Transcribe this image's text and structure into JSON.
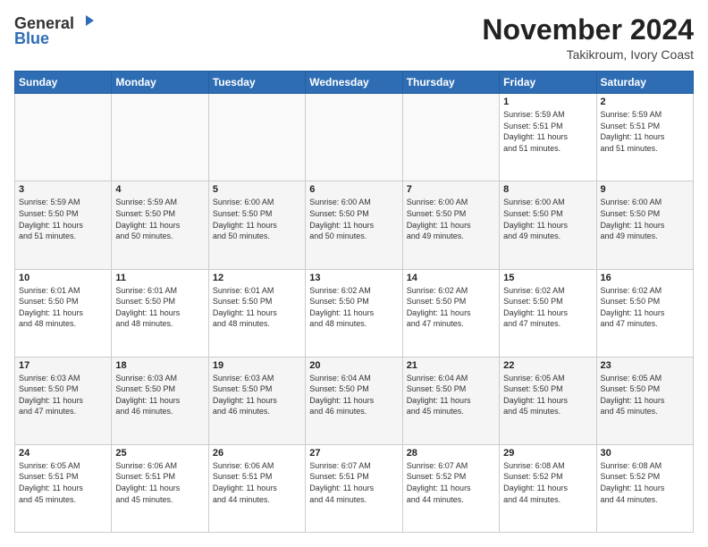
{
  "header": {
    "logo_line1": "General",
    "logo_line2": "Blue",
    "month": "November 2024",
    "location": "Takikroum, Ivory Coast"
  },
  "days_of_week": [
    "Sunday",
    "Monday",
    "Tuesday",
    "Wednesday",
    "Thursday",
    "Friday",
    "Saturday"
  ],
  "weeks": [
    [
      {
        "day": "",
        "info": ""
      },
      {
        "day": "",
        "info": ""
      },
      {
        "day": "",
        "info": ""
      },
      {
        "day": "",
        "info": ""
      },
      {
        "day": "",
        "info": ""
      },
      {
        "day": "1",
        "info": "Sunrise: 5:59 AM\nSunset: 5:51 PM\nDaylight: 11 hours\nand 51 minutes."
      },
      {
        "day": "2",
        "info": "Sunrise: 5:59 AM\nSunset: 5:51 PM\nDaylight: 11 hours\nand 51 minutes."
      }
    ],
    [
      {
        "day": "3",
        "info": "Sunrise: 5:59 AM\nSunset: 5:50 PM\nDaylight: 11 hours\nand 51 minutes."
      },
      {
        "day": "4",
        "info": "Sunrise: 5:59 AM\nSunset: 5:50 PM\nDaylight: 11 hours\nand 50 minutes."
      },
      {
        "day": "5",
        "info": "Sunrise: 6:00 AM\nSunset: 5:50 PM\nDaylight: 11 hours\nand 50 minutes."
      },
      {
        "day": "6",
        "info": "Sunrise: 6:00 AM\nSunset: 5:50 PM\nDaylight: 11 hours\nand 50 minutes."
      },
      {
        "day": "7",
        "info": "Sunrise: 6:00 AM\nSunset: 5:50 PM\nDaylight: 11 hours\nand 49 minutes."
      },
      {
        "day": "8",
        "info": "Sunrise: 6:00 AM\nSunset: 5:50 PM\nDaylight: 11 hours\nand 49 minutes."
      },
      {
        "day": "9",
        "info": "Sunrise: 6:00 AM\nSunset: 5:50 PM\nDaylight: 11 hours\nand 49 minutes."
      }
    ],
    [
      {
        "day": "10",
        "info": "Sunrise: 6:01 AM\nSunset: 5:50 PM\nDaylight: 11 hours\nand 48 minutes."
      },
      {
        "day": "11",
        "info": "Sunrise: 6:01 AM\nSunset: 5:50 PM\nDaylight: 11 hours\nand 48 minutes."
      },
      {
        "day": "12",
        "info": "Sunrise: 6:01 AM\nSunset: 5:50 PM\nDaylight: 11 hours\nand 48 minutes."
      },
      {
        "day": "13",
        "info": "Sunrise: 6:02 AM\nSunset: 5:50 PM\nDaylight: 11 hours\nand 48 minutes."
      },
      {
        "day": "14",
        "info": "Sunrise: 6:02 AM\nSunset: 5:50 PM\nDaylight: 11 hours\nand 47 minutes."
      },
      {
        "day": "15",
        "info": "Sunrise: 6:02 AM\nSunset: 5:50 PM\nDaylight: 11 hours\nand 47 minutes."
      },
      {
        "day": "16",
        "info": "Sunrise: 6:02 AM\nSunset: 5:50 PM\nDaylight: 11 hours\nand 47 minutes."
      }
    ],
    [
      {
        "day": "17",
        "info": "Sunrise: 6:03 AM\nSunset: 5:50 PM\nDaylight: 11 hours\nand 47 minutes."
      },
      {
        "day": "18",
        "info": "Sunrise: 6:03 AM\nSunset: 5:50 PM\nDaylight: 11 hours\nand 46 minutes."
      },
      {
        "day": "19",
        "info": "Sunrise: 6:03 AM\nSunset: 5:50 PM\nDaylight: 11 hours\nand 46 minutes."
      },
      {
        "day": "20",
        "info": "Sunrise: 6:04 AM\nSunset: 5:50 PM\nDaylight: 11 hours\nand 46 minutes."
      },
      {
        "day": "21",
        "info": "Sunrise: 6:04 AM\nSunset: 5:50 PM\nDaylight: 11 hours\nand 45 minutes."
      },
      {
        "day": "22",
        "info": "Sunrise: 6:05 AM\nSunset: 5:50 PM\nDaylight: 11 hours\nand 45 minutes."
      },
      {
        "day": "23",
        "info": "Sunrise: 6:05 AM\nSunset: 5:50 PM\nDaylight: 11 hours\nand 45 minutes."
      }
    ],
    [
      {
        "day": "24",
        "info": "Sunrise: 6:05 AM\nSunset: 5:51 PM\nDaylight: 11 hours\nand 45 minutes."
      },
      {
        "day": "25",
        "info": "Sunrise: 6:06 AM\nSunset: 5:51 PM\nDaylight: 11 hours\nand 45 minutes."
      },
      {
        "day": "26",
        "info": "Sunrise: 6:06 AM\nSunset: 5:51 PM\nDaylight: 11 hours\nand 44 minutes."
      },
      {
        "day": "27",
        "info": "Sunrise: 6:07 AM\nSunset: 5:51 PM\nDaylight: 11 hours\nand 44 minutes."
      },
      {
        "day": "28",
        "info": "Sunrise: 6:07 AM\nSunset: 5:52 PM\nDaylight: 11 hours\nand 44 minutes."
      },
      {
        "day": "29",
        "info": "Sunrise: 6:08 AM\nSunset: 5:52 PM\nDaylight: 11 hours\nand 44 minutes."
      },
      {
        "day": "30",
        "info": "Sunrise: 6:08 AM\nSunset: 5:52 PM\nDaylight: 11 hours\nand 44 minutes."
      }
    ]
  ]
}
